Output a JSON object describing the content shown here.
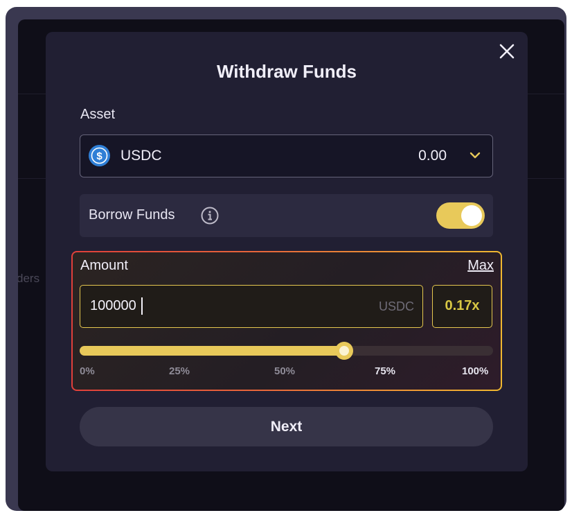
{
  "background": {
    "partial_text": "ders"
  },
  "modal": {
    "title": "Withdraw Funds",
    "asset_label": "Asset",
    "asset": {
      "icon": "usdc-coin-icon",
      "name": "USDC",
      "balance": "0.00",
      "dropdown_icon": "chevron-down-icon"
    },
    "borrow": {
      "label": "Borrow Funds",
      "info_icon": "info-icon",
      "enabled": true
    },
    "amount": {
      "label": "Amount",
      "max_label": "Max",
      "value": "100000",
      "unit": "USDC",
      "leverage": "0.17x",
      "slider_fraction": 0.64,
      "ticks": [
        "0%",
        "25%",
        "50%",
        "75%",
        "100%"
      ]
    },
    "next_label": "Next"
  },
  "colors": {
    "accent": "#e8c95a",
    "leverage_text": "#d9c844",
    "tick_active": "#8f8c98",
    "tick_emphasis": "#e6e4ee",
    "border_gradient_start": "#e0403a",
    "border_gradient_end": "#f0b830"
  }
}
